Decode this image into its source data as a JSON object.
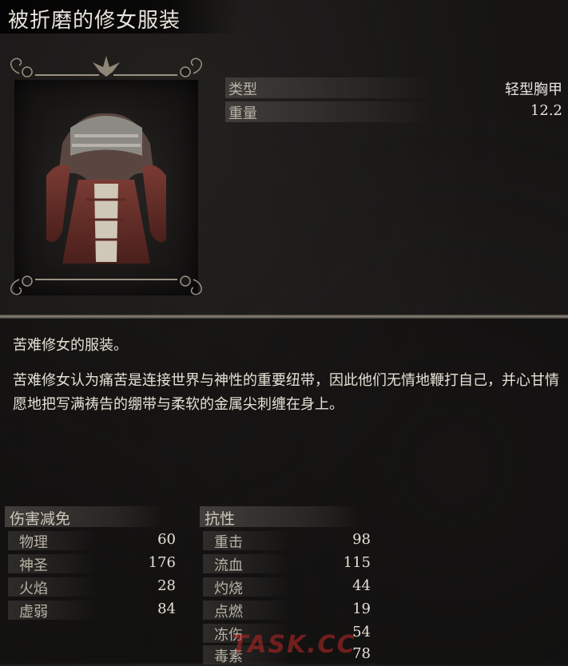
{
  "item": {
    "name": "被折磨的修女服装"
  },
  "attributes": [
    {
      "label": "类型",
      "value": "轻型胸甲"
    },
    {
      "label": "重量",
      "value": "12.2"
    }
  ],
  "description": {
    "line1": "苦难修女的服装。",
    "line2": "苦难修女认为痛苦是连接世界与神性的重要纽带，因此他们无情地鞭打自己，并心甘情愿地把写满祷告的绷带与柔软的金属尖刺缠在身上。"
  },
  "damage_negation": {
    "header": "伤害减免",
    "rows": [
      {
        "label": "物理",
        "value": "60"
      },
      {
        "label": "神圣",
        "value": "176"
      },
      {
        "label": "火焰",
        "value": "28"
      },
      {
        "label": "虚弱",
        "value": "84"
      }
    ]
  },
  "resistance": {
    "header": "抗性",
    "rows": [
      {
        "label": "重击",
        "value": "98"
      },
      {
        "label": "流血",
        "value": "115"
      },
      {
        "label": "灼烧",
        "value": "44"
      },
      {
        "label": "点燃",
        "value": "19"
      },
      {
        "label": "冻伤",
        "value": "54"
      },
      {
        "label": "毒素",
        "value": "78"
      }
    ]
  },
  "watermark": "TASK.CC"
}
